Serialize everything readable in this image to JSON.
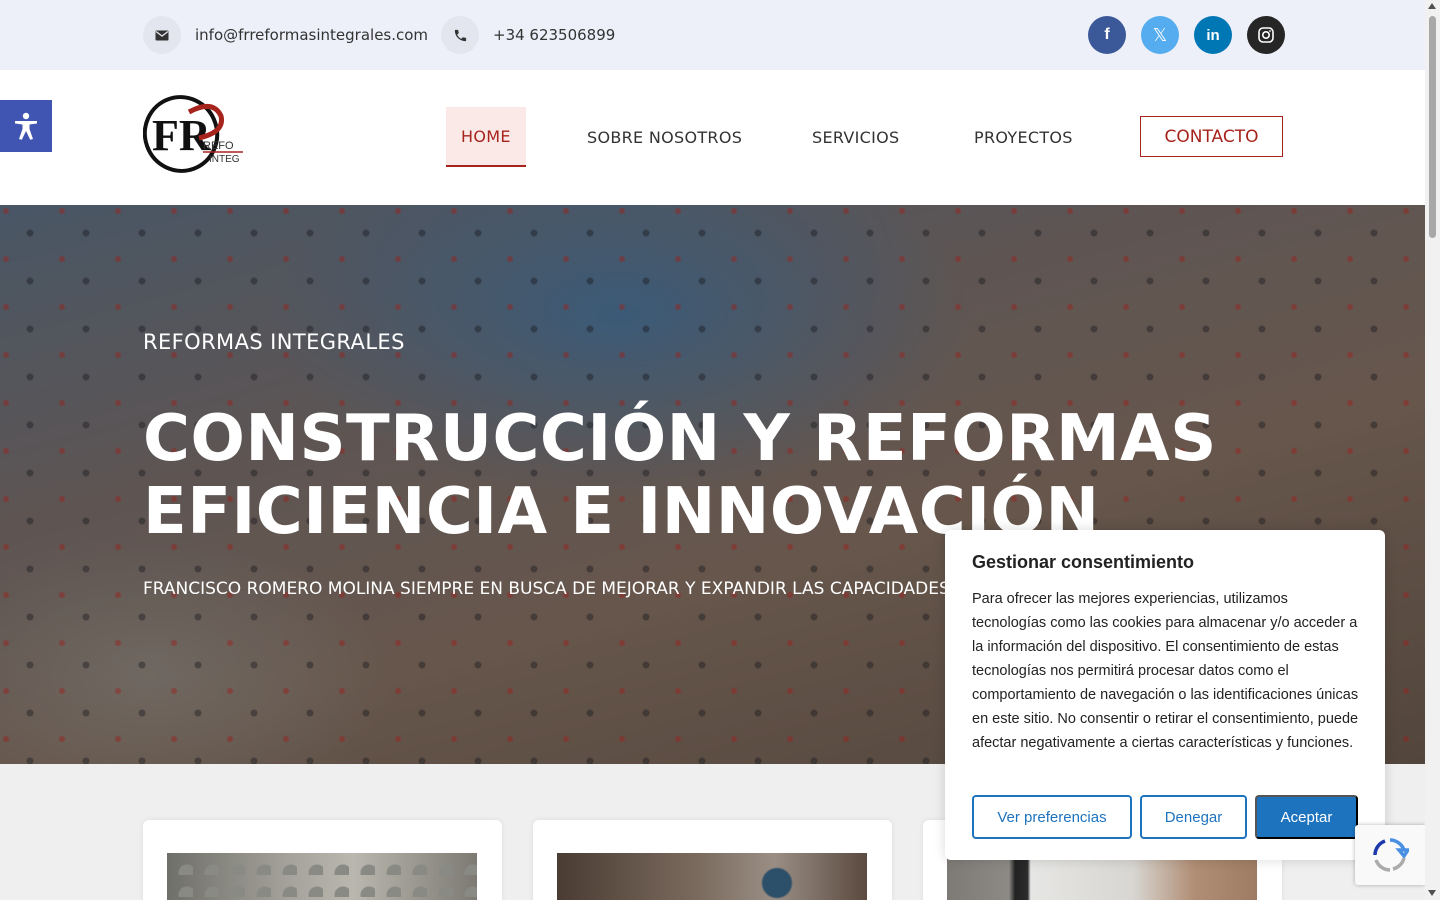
{
  "topbar": {
    "email": "info@frreformasintegrales.com",
    "phone": "+34 623506899",
    "email_icon": "envelope-icon",
    "phone_icon": "phone-icon",
    "socials": [
      {
        "name": "facebook-icon",
        "glyph": "f",
        "color": "#3b5998"
      },
      {
        "name": "x-twitter-icon",
        "glyph": "𝕏",
        "color": "#55acee"
      },
      {
        "name": "linkedin-icon",
        "glyph": "in",
        "color": "#0077b5"
      },
      {
        "name": "instagram-icon",
        "glyph": "◎",
        "color": "#262626"
      }
    ]
  },
  "header": {
    "logo": {
      "mark": "FR",
      "line1": "REFO",
      "line2": "INTEG"
    },
    "nav": {
      "home": "HOME",
      "about": "SOBRE NOSOTROS",
      "services": "SERVICIOS",
      "projects": "PROYECTOS",
      "contact": "CONTACTO"
    }
  },
  "hero": {
    "subtitle": "REFORMAS INTEGRALES",
    "title_line1": "CONSTRUCCIÓN Y REFORMAS",
    "title_line2": "EFICIENCIA E INNOVACIÓN",
    "description": "FRANCISCO ROMERO MOLINA SIEMPRE EN BUSCA DE MEJORAR Y EXPANDIR LAS CAPACIDADES Y AMPLIANDO SERVICIOS"
  },
  "cookie": {
    "title": "Gestionar consentimiento",
    "text": "Para ofrecer las mejores experiencias, utilizamos tecnologías como las cookies para almacenar y/o acceder a la información del dispositivo. El consentimiento de estas tecnologías nos permitirá procesar datos como el comportamiento de navegación o las identificaciones únicas en este sitio. No consentir o retirar el consentimiento, puede afectar negativamente a ciertas características y funciones.",
    "btn_prefs": "Ver preferencias",
    "btn_deny": "Denegar",
    "btn_accept": "Aceptar"
  },
  "colors": {
    "brand_red": "#a7241d",
    "cookie_blue": "#1e73be",
    "a11y_blue": "#4054b2",
    "topbar_bg": "#edf0f9"
  }
}
